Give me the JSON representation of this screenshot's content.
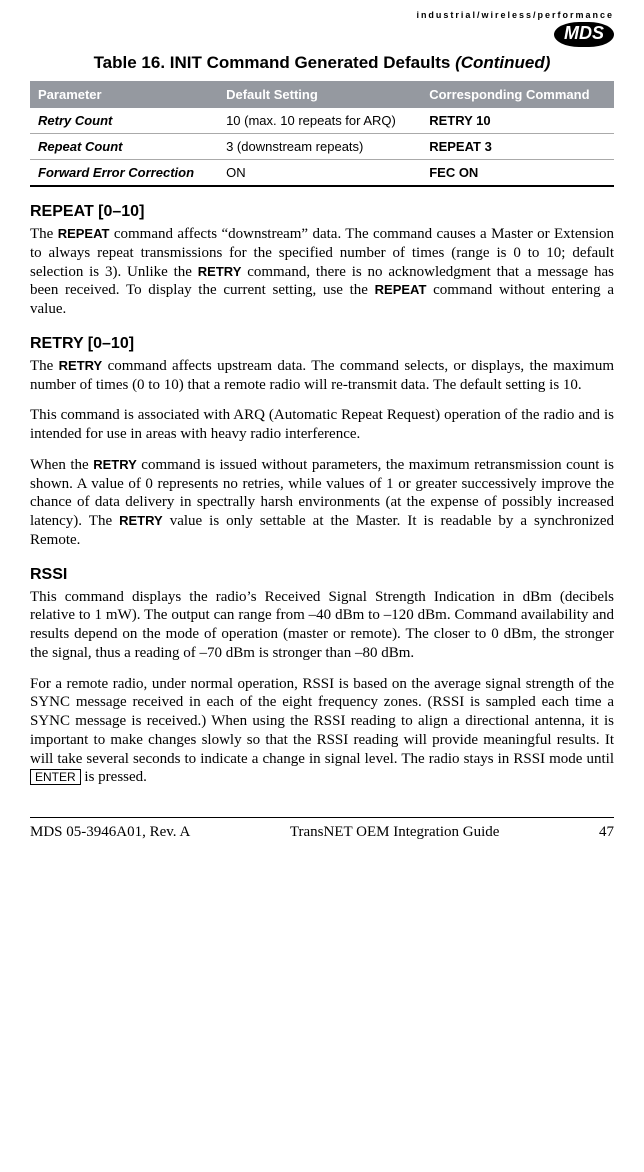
{
  "header": {
    "tagline": "industrial/wireless/performance",
    "logo_text": "MDS"
  },
  "table": {
    "caption_main": "Table 16. INIT Command Generated Defaults ",
    "caption_cont": "(Continued)",
    "headers": {
      "param": "Parameter",
      "default": "Default Setting",
      "command": "Corresponding Command"
    },
    "rows": [
      {
        "param": "Retry Count",
        "default": "10 (max. 10 repeats for ARQ)",
        "command": "RETRY 10"
      },
      {
        "param": "Repeat Count",
        "default": "3 (downstream repeats)",
        "command": "REPEAT 3"
      },
      {
        "param": "Forward Error Correction",
        "default": "ON",
        "command": "FEC ON"
      }
    ]
  },
  "sections": {
    "repeat": {
      "heading": "REPEAT [0–10]",
      "p1a": "The ",
      "p1_cmd1": "REPEAT",
      "p1b": " command affects “downstream” data. The command causes a Master or Extension to always repeat transmissions for the specified number of times (range is 0 to 10; default selection is 3). Unlike the ",
      "p1_cmd2": "RETRY",
      "p1c": " command, there is no acknowledgment that a message has been received. To display the current setting, use the ",
      "p1_cmd3": "REPEAT",
      "p1d": " command without entering a value."
    },
    "retry": {
      "heading": "RETRY [0–10]",
      "p1a": "The ",
      "p1_cmd1": "RETRY",
      "p1b": " command affects upstream data. The command selects, or displays, the maximum number of times (0 to 10) that a remote radio will re-transmit data. The default setting is 10.",
      "p2": "This command is associated with ARQ (Automatic Repeat Request) operation of the radio and is intended for use in areas with heavy radio interference.",
      "p3a": "When the ",
      "p3_cmd1": "RETRY",
      "p3b": " command is issued without parameters, the maximum retransmission count is shown. A value of 0 represents no retries, while values of 1 or greater successively improve the chance of data delivery in spectrally harsh environments (at the expense of possibly increased latency). The ",
      "p3_cmd2": "RETRY",
      "p3c": " value is only settable at the Master. It is readable by a synchronized Remote."
    },
    "rssi": {
      "heading": "RSSI",
      "p1": "This command displays the radio’s Received Signal Strength Indication in dBm (decibels relative to 1 mW). The output can range from –40 dBm to –120 dBm. Command availability and results depend on the mode of operation (master or remote). The closer to 0 dBm, the stronger the signal, thus a reading of –70 dBm is stronger than –80 dBm.",
      "p2a": "For a remote radio, under normal operation, RSSI is based on the average signal strength of the SYNC message received in each of the eight frequency zones. (RSSI is sampled each time a SYNC message is received.) When using the RSSI reading to align a directional antenna, it is important to make changes slowly so that the RSSI reading will provide meaningful results. It will take several seconds to indicate a change in signal level. The radio stays in RSSI mode until ",
      "p2_key": "ENTER",
      "p2b": " is pressed."
    }
  },
  "footer": {
    "left": "MDS 05-3946A01, Rev.  A",
    "center": "TransNET OEM Integration Guide",
    "right": "47"
  }
}
